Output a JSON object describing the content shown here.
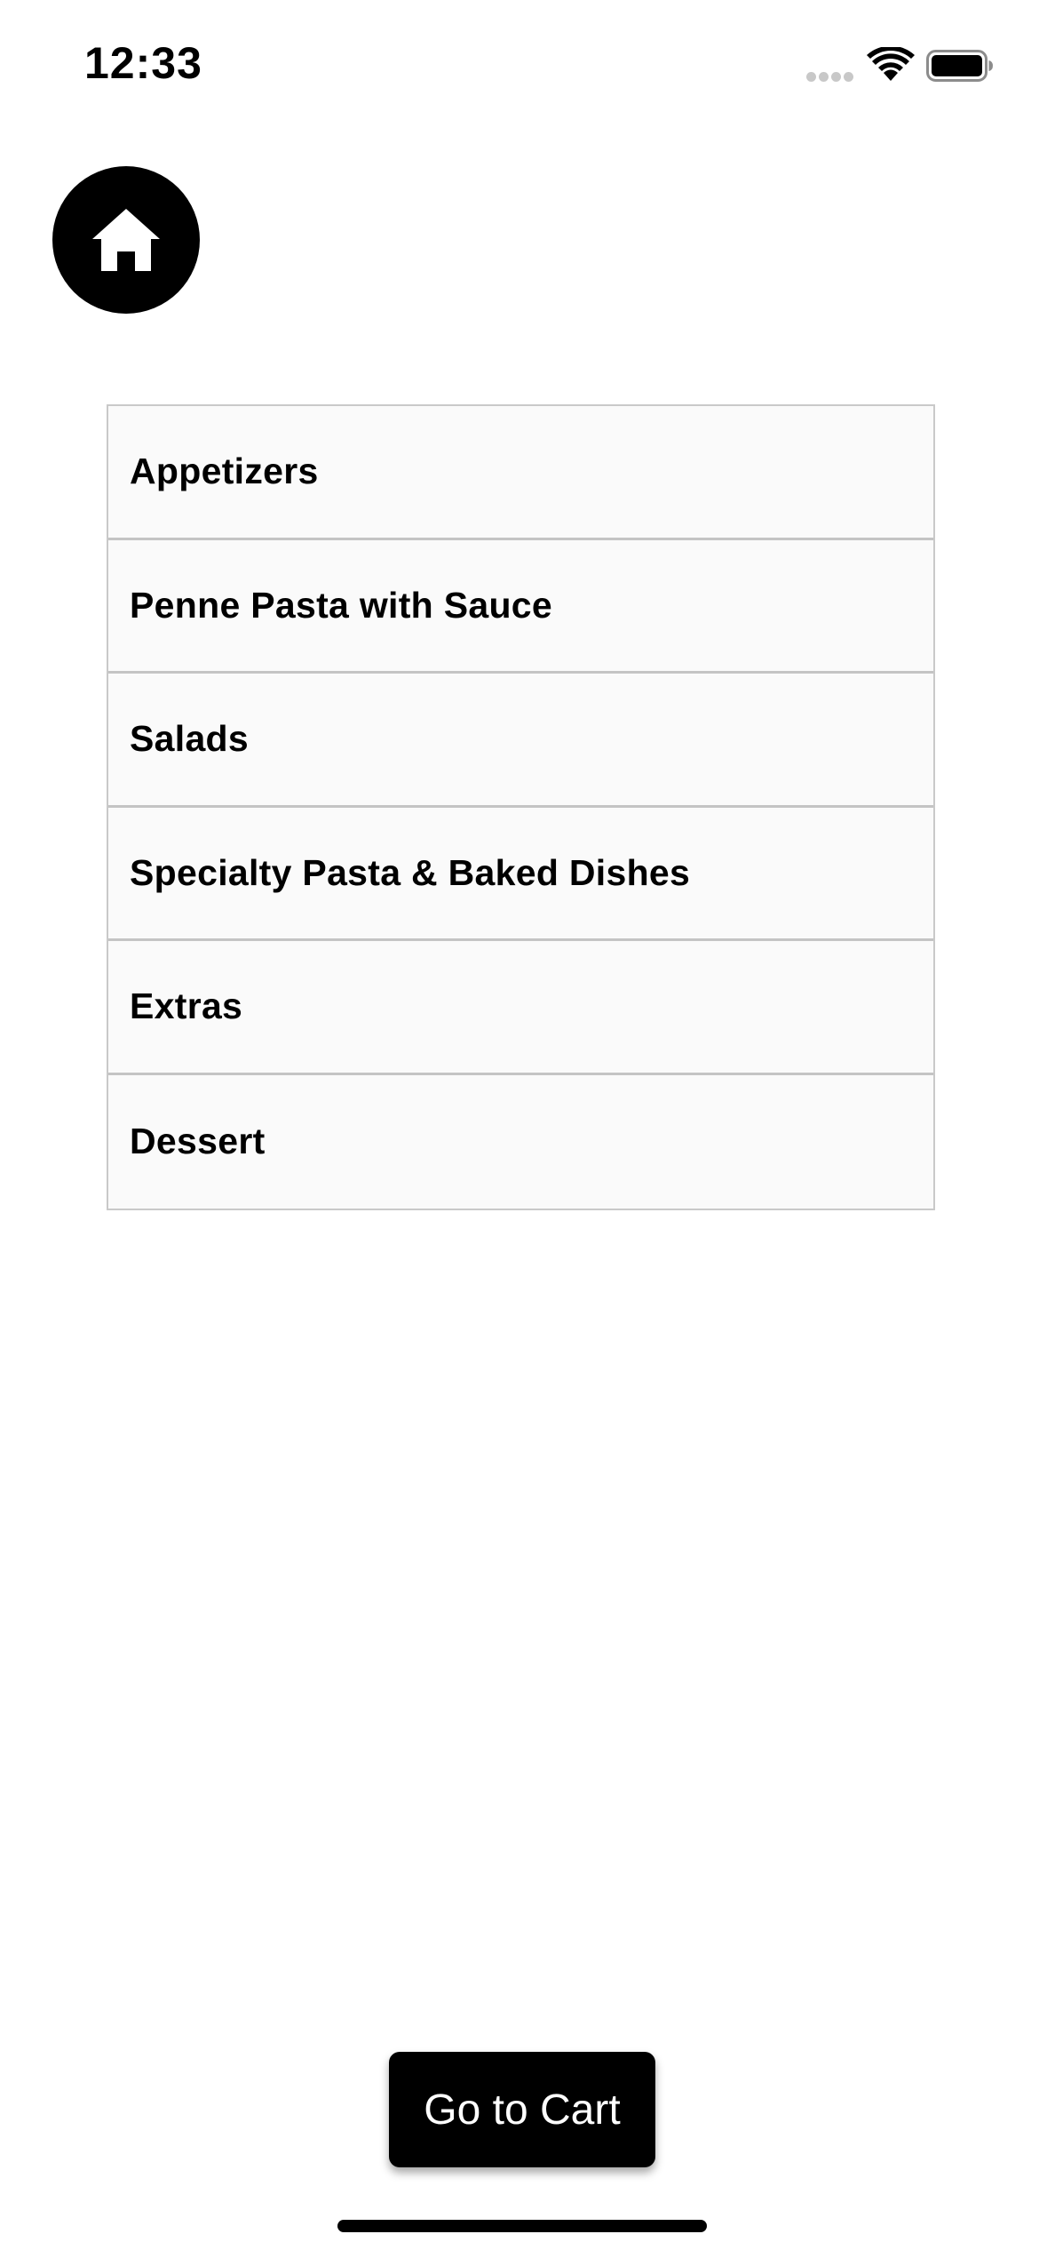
{
  "status_bar": {
    "time": "12:33",
    "icons": [
      "cellular-signal-icon",
      "wifi-icon",
      "battery-icon"
    ]
  },
  "home_button": {
    "icon": "home-icon"
  },
  "categories": [
    {
      "label": "Appetizers"
    },
    {
      "label": "Penne Pasta with Sauce"
    },
    {
      "label": "Salads"
    },
    {
      "label": "Specialty Pasta & Baked Dishes"
    },
    {
      "label": "Extras"
    },
    {
      "label": "Dessert"
    }
  ],
  "cart_button": {
    "label": "Go to Cart"
  },
  "colors": {
    "background": "#ffffff",
    "list_background": "#fafafa",
    "list_border": "#c9c9c9",
    "primary": "#000000",
    "button_text": "#ffffff"
  }
}
